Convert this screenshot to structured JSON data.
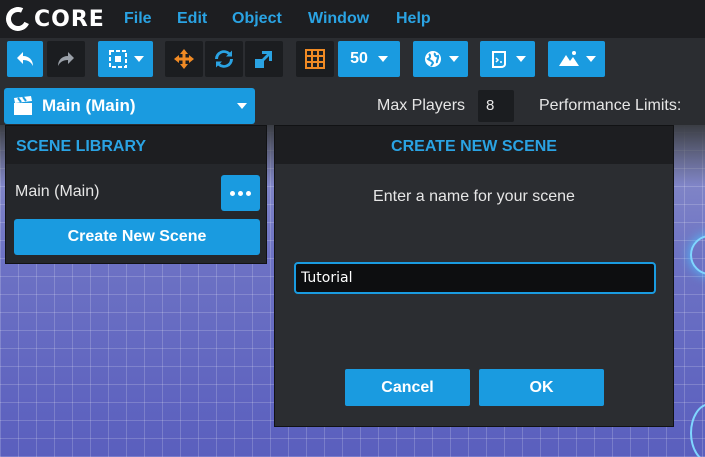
{
  "app": {
    "logo_text": "CORE"
  },
  "menu": {
    "items": [
      "File",
      "Edit",
      "Object",
      "Window",
      "Help"
    ]
  },
  "toolbar": {
    "undo_icon": "undo-icon",
    "redo_icon": "redo-icon",
    "grid_size_value": "50",
    "accent_color": "#1a9be0"
  },
  "scene_selector": {
    "label": "Main (Main)"
  },
  "game_settings": {
    "max_players_label": "Max Players",
    "max_players_value": "8",
    "performance_limits_label": "Performance Limits:"
  },
  "scene_library": {
    "title": "SCENE LIBRARY",
    "scenes": [
      {
        "name": "Main (Main)"
      }
    ],
    "create_button_label": "Create New Scene"
  },
  "create_scene_dialog": {
    "title": "CREATE NEW SCENE",
    "prompt": "Enter a name for your scene",
    "name_value": "Tutorial",
    "cancel_label": "Cancel",
    "ok_label": "OK"
  }
}
